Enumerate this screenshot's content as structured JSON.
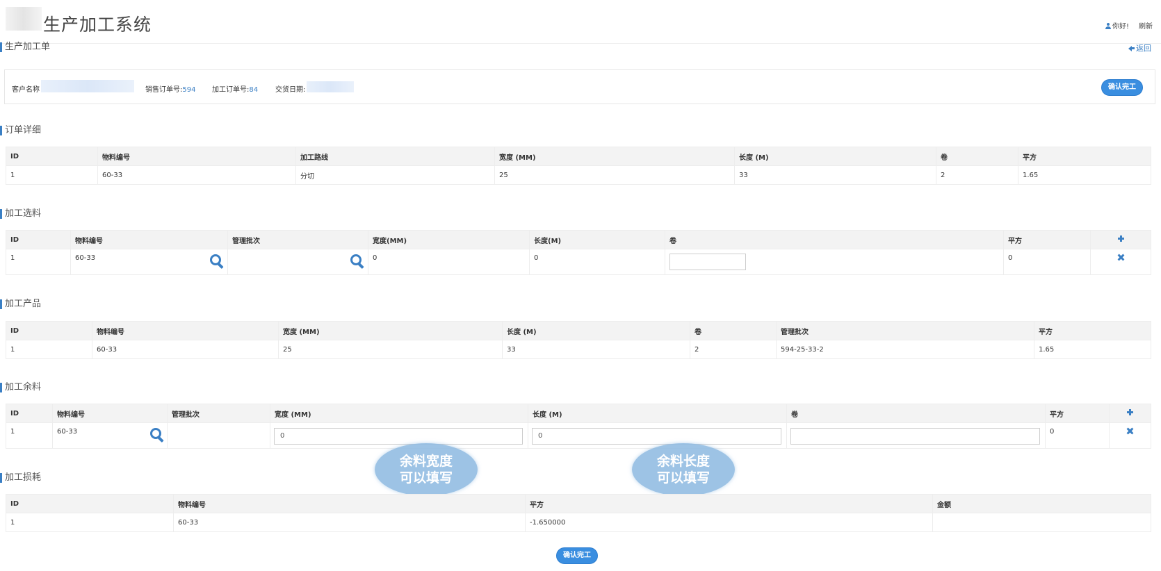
{
  "header": {
    "app_title": "生产加工系统",
    "greeting": "你好!",
    "refresh": "刷新"
  },
  "page": {
    "title": "生产加工单",
    "back": "返回"
  },
  "info": {
    "customer_label": "客户名称",
    "sales_order_label": "销售订单号:",
    "sales_order_value": "594",
    "process_order_label": "加工订单号:",
    "process_order_value": "84",
    "delivery_label": "交货日期:",
    "confirm_button": "确认完工"
  },
  "order_detail": {
    "title": "订单详细",
    "headers": [
      "ID",
      "物料编号",
      "加工路线",
      "宽度 (MM)",
      "长度 (M)",
      "卷",
      "平方"
    ],
    "rows": [
      [
        "1",
        "60-33",
        "分切",
        "25",
        "33",
        "2",
        "1.65"
      ]
    ]
  },
  "material_selection": {
    "title": "加工选料",
    "headers": [
      "ID",
      "物料编号",
      "管理批次",
      "宽度(MM)",
      "长度(M)",
      "卷",
      "平方"
    ],
    "rows": [
      {
        "id": "1",
        "material": "60-33",
        "batch": "",
        "width": "0",
        "length": "0",
        "rolls": "",
        "area": "0"
      }
    ]
  },
  "products": {
    "title": "加工产品",
    "headers": [
      "ID",
      "物料编号",
      "宽度 (MM)",
      "长度 (M)",
      "卷",
      "管理批次",
      "平方"
    ],
    "rows": [
      [
        "1",
        "60-33",
        "25",
        "33",
        "2",
        "594-25-33-2",
        "1.65"
      ]
    ]
  },
  "remainder": {
    "title": "加工余料",
    "headers": [
      "ID",
      "物料编号",
      "管理批次",
      "宽度 (MM)",
      "长度 (M)",
      "卷",
      "平方"
    ],
    "rows": [
      {
        "id": "1",
        "material": "60-33",
        "batch": "",
        "width": "0",
        "length": "0",
        "rolls": "",
        "area": "0"
      }
    ]
  },
  "loss": {
    "title": "加工损耗",
    "headers": [
      "ID",
      "物料编号",
      "平方",
      "金额"
    ],
    "rows": [
      [
        "1",
        "60-33",
        "-1.650000",
        ""
      ]
    ]
  },
  "callouts": {
    "width_line1": "余料宽度",
    "width_line2": "可以填写",
    "length_line1": "余料长度",
    "length_line2": "可以填写"
  },
  "footer": {
    "confirm_button": "确认完工"
  },
  "colors": {
    "accent": "#3a7fc4",
    "button": "#3a8ee0"
  }
}
